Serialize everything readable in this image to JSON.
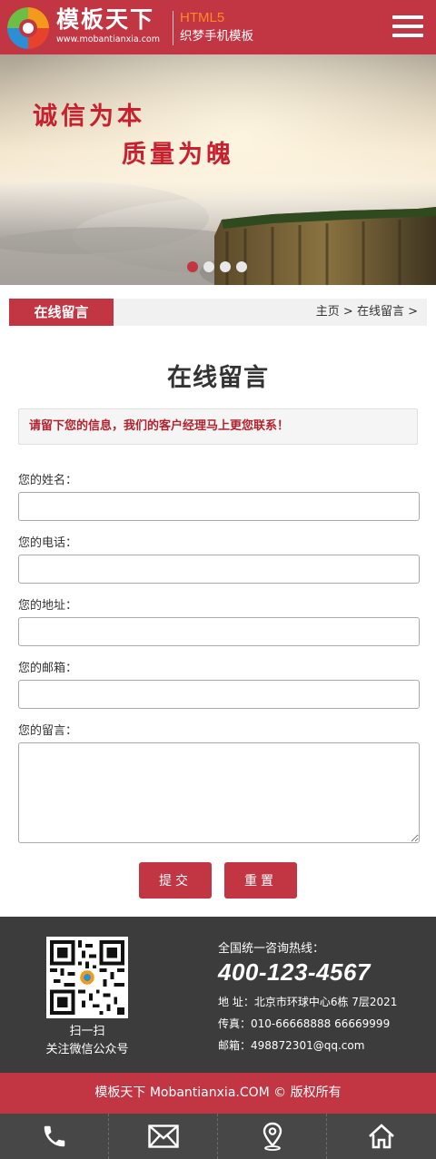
{
  "header": {
    "logo_title": "模板天下",
    "logo_url": "www.mobantianxia.com",
    "badge_top": "HTML5",
    "badge_bottom": "织梦手机模板",
    "menu_icon": "hamburger-menu-icon"
  },
  "banner": {
    "slogan_line1": "诚信为本",
    "slogan_line2": "质量为魄",
    "slide_count": 4,
    "active_slide": 1
  },
  "titlebar": {
    "section_tag": "在线留言",
    "breadcrumb": {
      "home": "主页",
      "sep": ">",
      "current": "在线留言",
      "trailing_sep": ">"
    }
  },
  "page": {
    "title": "在线留言",
    "notice": "请留下您的信息，我们的客户经理马上更您联系！"
  },
  "form": {
    "name_label": "您的姓名：",
    "phone_label": "您的电话：",
    "address_label": "您的地址：",
    "email_label": "您的邮箱：",
    "message_label": "您的留言：",
    "name_value": "",
    "phone_value": "",
    "address_value": "",
    "email_value": "",
    "message_value": "",
    "submit_label": "提交",
    "reset_label": "重置"
  },
  "footer": {
    "qr_caption1": "扫一扫",
    "qr_caption2": "关注微信公众号",
    "hotline_label": "全国统一咨询热线：",
    "hotline_number": "400-123-4567",
    "address": "地 址：北京市环球中心6栋 7层2021",
    "fax": "传真：010-66668888 66669999",
    "email": "邮箱：498872301@qq.com",
    "copyright": "模板天下 Mobantianxia.COM © 版权所有"
  },
  "bottom_nav": {
    "items": [
      "phone-icon",
      "mail-icon",
      "location-pin-icon",
      "home-icon"
    ]
  },
  "colors": {
    "brand_red": "#c23543",
    "footer_dark": "#3c3c3c",
    "nav_dark": "#474747",
    "badge_orange": "#ff8a22"
  }
}
